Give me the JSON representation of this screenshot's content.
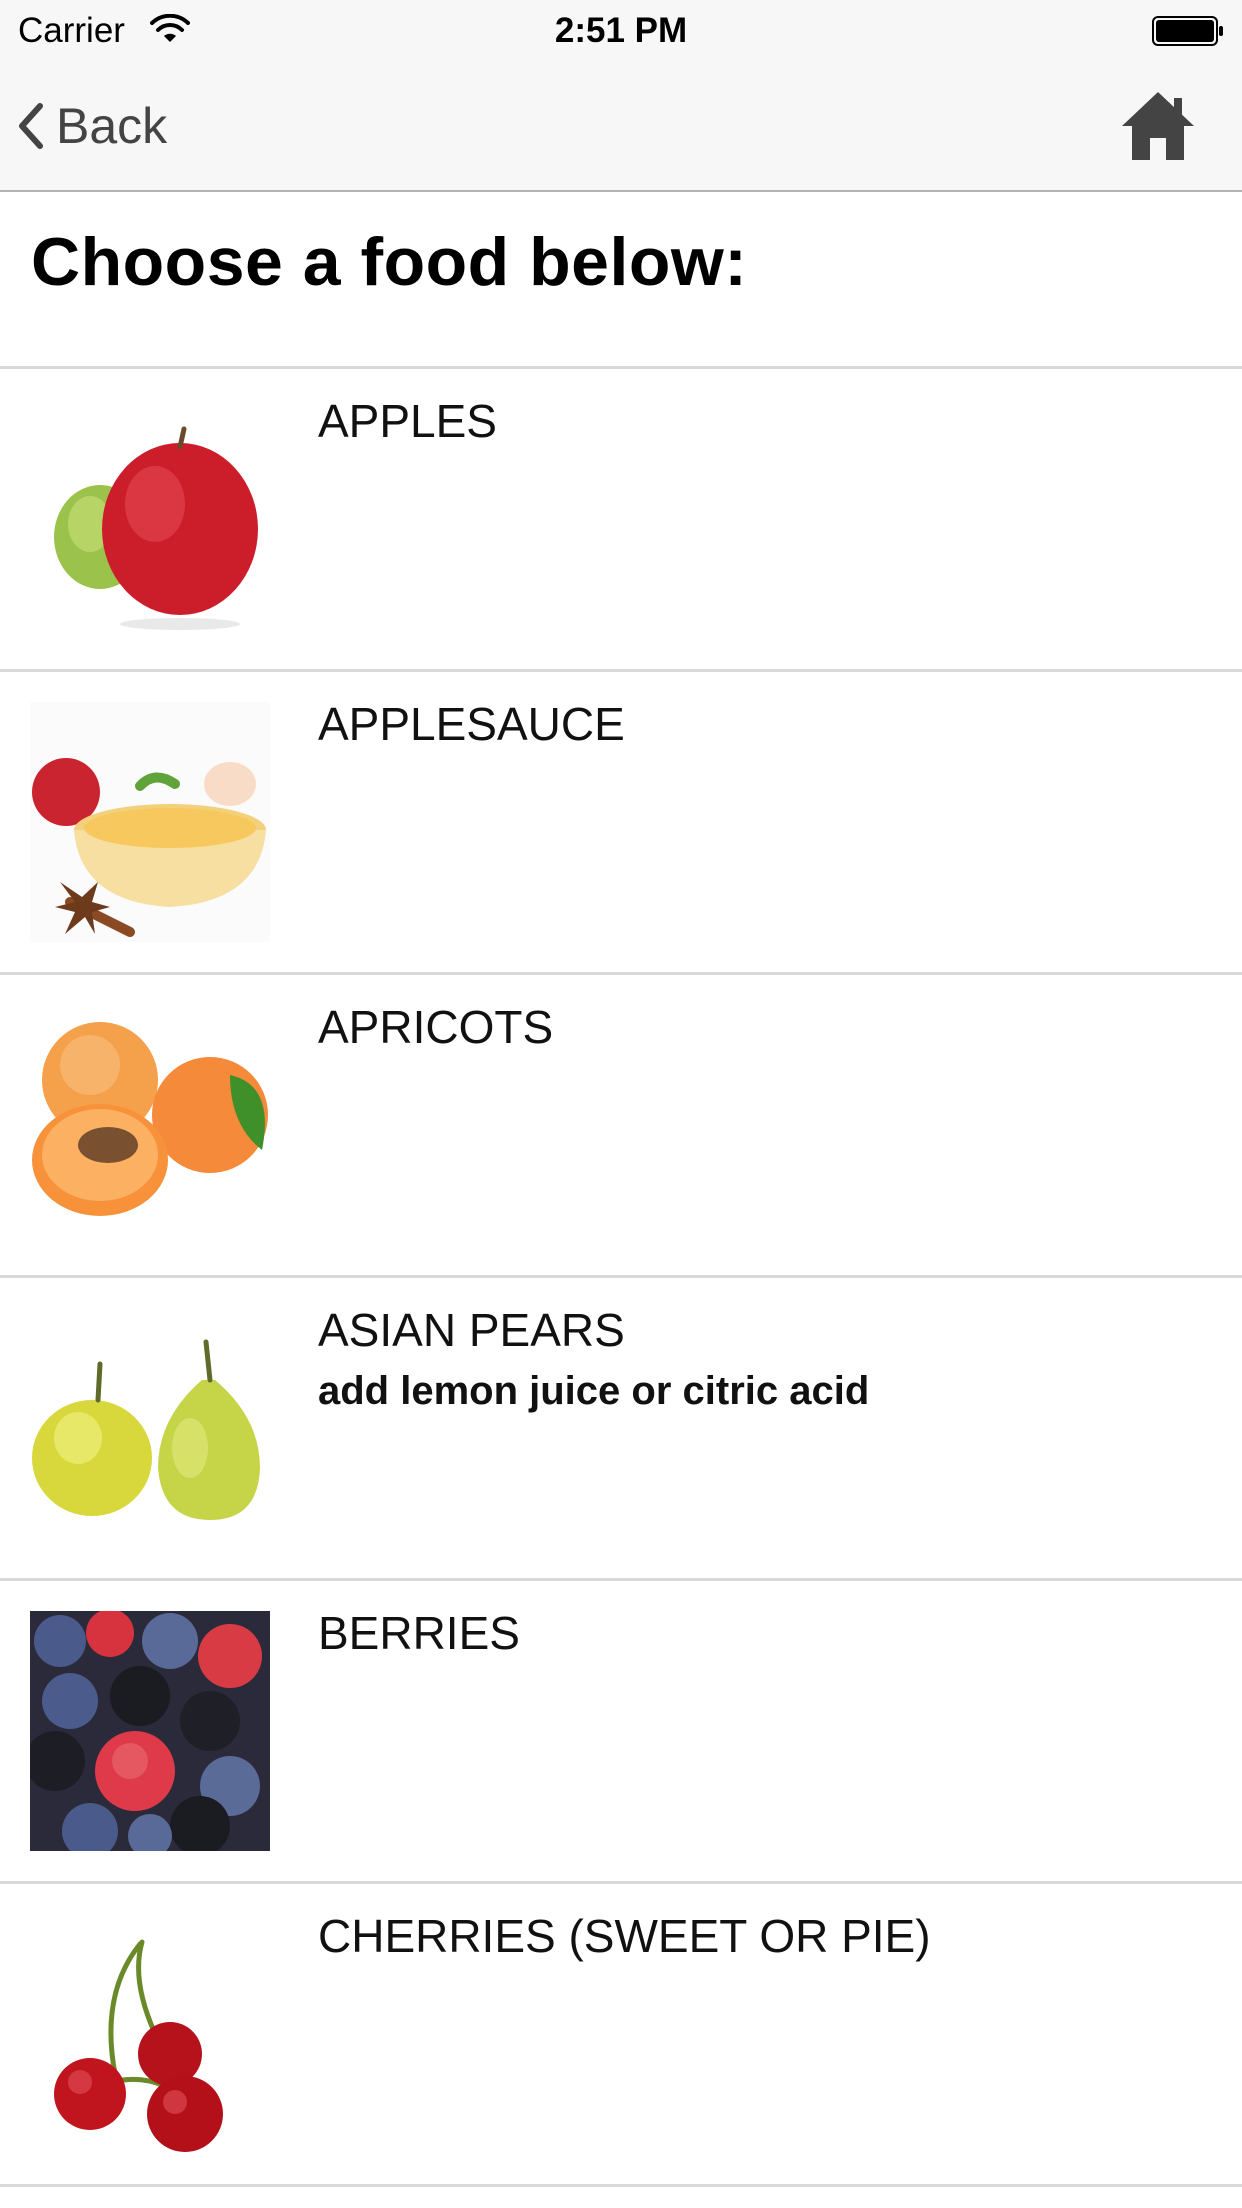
{
  "status_bar": {
    "carrier": "Carrier",
    "time": "2:51 PM"
  },
  "nav": {
    "back_label": "Back",
    "home_icon": "home-icon"
  },
  "page": {
    "title": "Choose a food below:"
  },
  "foods": [
    {
      "name": "APPLES",
      "note": ""
    },
    {
      "name": "APPLESAUCE",
      "note": ""
    },
    {
      "name": "APRICOTS",
      "note": ""
    },
    {
      "name": "ASIAN PEARS",
      "note": "add lemon juice or citric acid"
    },
    {
      "name": "BERRIES",
      "note": ""
    },
    {
      "name": "CHERRIES (SWEET OR PIE)",
      "note": ""
    }
  ]
}
